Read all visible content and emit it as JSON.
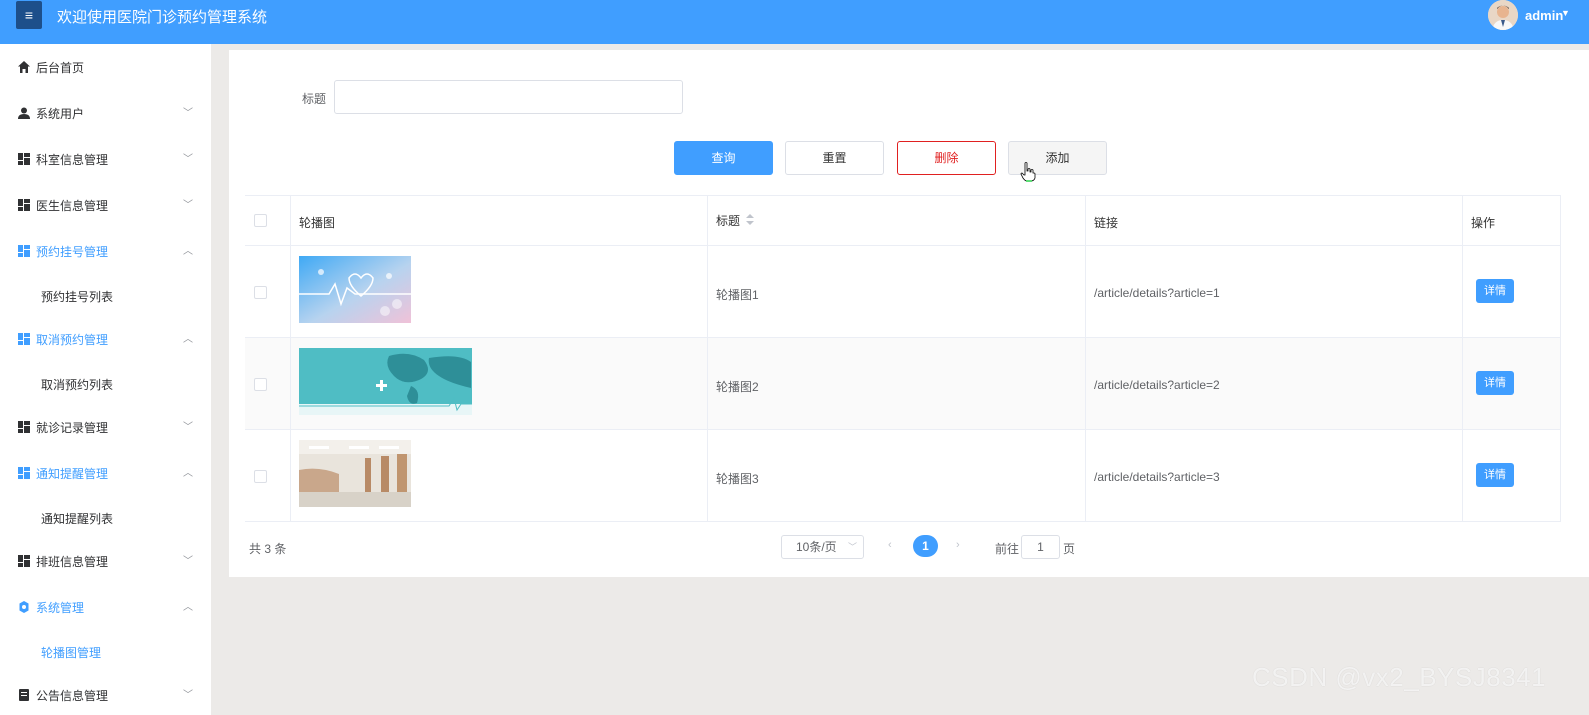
{
  "header": {
    "menu_icon": "hamburger-icon",
    "title": "欢迎使用医院门诊预约管理系统",
    "user_name": "admin"
  },
  "sidebar": {
    "items": [
      {
        "label": "后台首页",
        "icon": "home-icon"
      },
      {
        "label": "系统用户",
        "icon": "user-icon"
      },
      {
        "label": "科室信息管理",
        "icon": "grid-icon"
      },
      {
        "label": "医生信息管理",
        "icon": "grid-icon"
      },
      {
        "label": "预约挂号管理",
        "icon": "grid-icon"
      },
      {
        "label": "预约挂号列表"
      },
      {
        "label": "取消预约管理",
        "icon": "grid-icon"
      },
      {
        "label": "取消预约列表"
      },
      {
        "label": "就诊记录管理",
        "icon": "grid-icon"
      },
      {
        "label": "通知提醒管理",
        "icon": "grid-icon"
      },
      {
        "label": "通知提醒列表"
      },
      {
        "label": "排班信息管理",
        "icon": "grid-icon"
      },
      {
        "label": "系统管理",
        "icon": "settings-icon"
      },
      {
        "label": "轮播图管理"
      },
      {
        "label": "公告信息管理",
        "icon": "notice-icon"
      }
    ]
  },
  "search": {
    "label": "标题",
    "value": ""
  },
  "actions": {
    "query": "查询",
    "reset": "重置",
    "delete": "删除",
    "add": "添加"
  },
  "table": {
    "headers": {
      "image": "轮播图",
      "title": "标题",
      "link": "链接",
      "action": "操作"
    },
    "rows": [
      {
        "title": "轮播图1",
        "link": "/article/details?article=1",
        "action": "详情"
      },
      {
        "title": "轮播图2",
        "link": "/article/details?article=2",
        "action": "详情"
      },
      {
        "title": "轮播图3",
        "link": "/article/details?article=3",
        "action": "详情"
      }
    ]
  },
  "pagination": {
    "total": "共 3 条",
    "page_size": "10条/页",
    "current_page": "1",
    "goto_label": "前往",
    "goto_value": "1",
    "goto_unit": "页"
  },
  "watermark": "CSDN @vx2_BYSJ8341",
  "colors": {
    "primary": "#409eff",
    "danger": "#e02020",
    "header": "#409eff"
  }
}
